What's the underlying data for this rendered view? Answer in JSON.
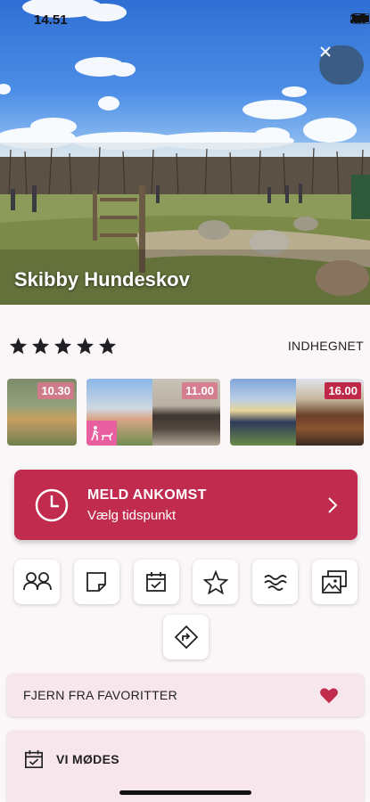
{
  "status_bar": {
    "time": "14.51"
  },
  "park": {
    "name": "Skibby Hundeskov",
    "rating": 5,
    "tag": "INDHEGNET"
  },
  "photos": [
    {
      "time": "10.30",
      "style": "light"
    },
    {
      "time": "11.00",
      "style": "light"
    },
    {
      "time": "16.00",
      "style": "dark"
    }
  ],
  "arrival": {
    "title": "MELD ANKOMST",
    "subtitle": "Vælg tidspunkt"
  },
  "actions": [
    "people-icon",
    "note-icon",
    "calendar-check-icon",
    "star-outline-icon",
    "water-icon",
    "photos-icon",
    "directions-icon"
  ],
  "favorite": {
    "label": "FJERN FRA FAVORITTER"
  },
  "meet": {
    "label": "VI MØDES"
  },
  "colors": {
    "accent": "#c02b4e",
    "card": "#f7e6ec",
    "heart": "#c02b4e"
  }
}
